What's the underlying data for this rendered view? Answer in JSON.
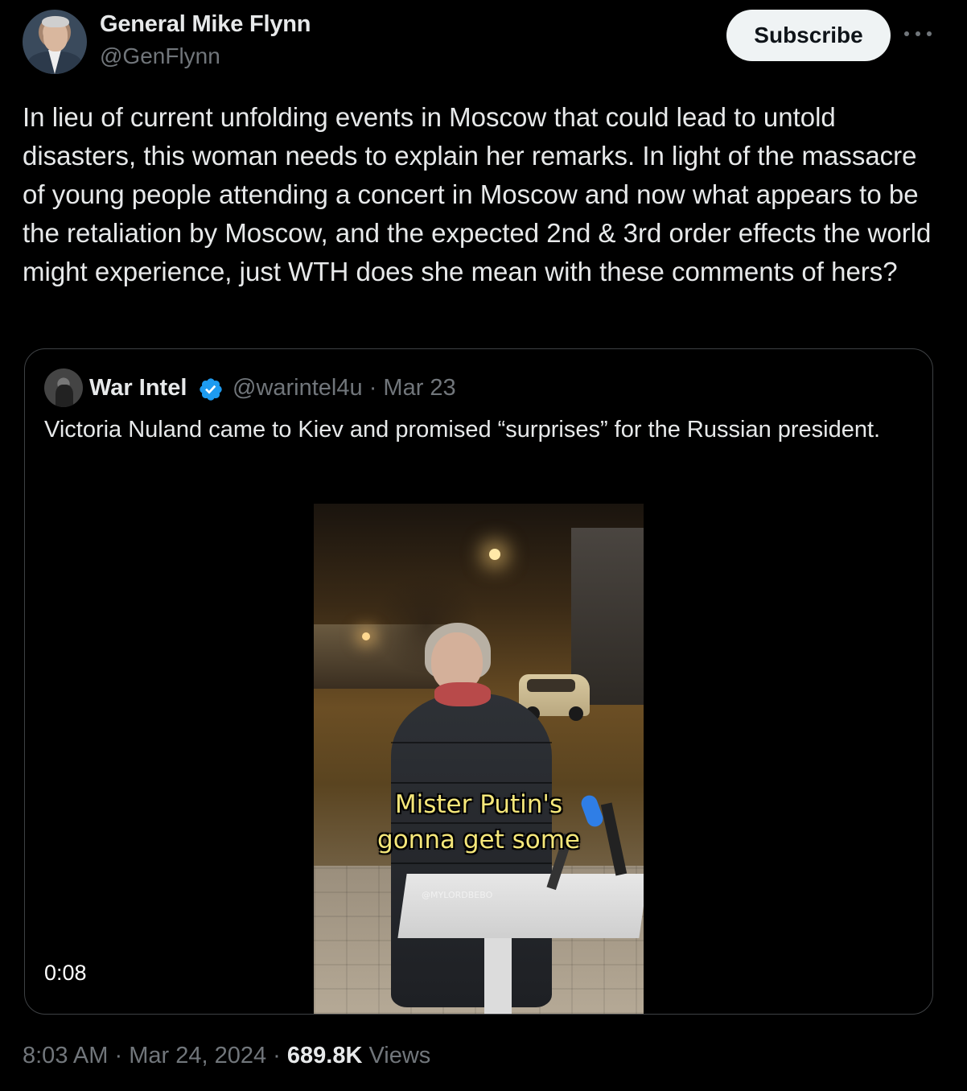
{
  "author": {
    "name": "General Mike Flynn",
    "handle": "@GenFlynn"
  },
  "actions": {
    "subscribe_label": "Subscribe",
    "more_icon": "more-horizontal-icon"
  },
  "tweet": {
    "text": "In lieu of current unfolding events in Moscow that could lead to untold disasters, this woman needs to explain her remarks. In light of the massacre of young people attending a concert in Moscow and now what appears to be the retaliation by Moscow, and the expected 2nd & 3rd order effects the world might experience, just WTH does she mean with these comments of hers?"
  },
  "quoted": {
    "name": "War Intel",
    "verified_icon": "verified-badge-icon",
    "handle": "@warintel4u",
    "separator": "·",
    "date": "Mar 23",
    "text": "Victoria Nuland came to Kiev and promised “surprises” for the Russian president.",
    "video": {
      "caption_line1": "Mister Putin's",
      "caption_line2": "gonna get some",
      "watermark": "@MYLORDBEBO",
      "duration": "0:08"
    }
  },
  "footer": {
    "time": "8:03 AM",
    "sep1": "·",
    "date": "Mar 24, 2024",
    "sep2": "·",
    "views_count": "689.8K",
    "views_label": "Views"
  },
  "colors": {
    "background": "#000000",
    "text": "#e7e9ea",
    "muted": "#71767b",
    "verified": "#1d9bf0",
    "button_bg": "#eff3f4"
  }
}
